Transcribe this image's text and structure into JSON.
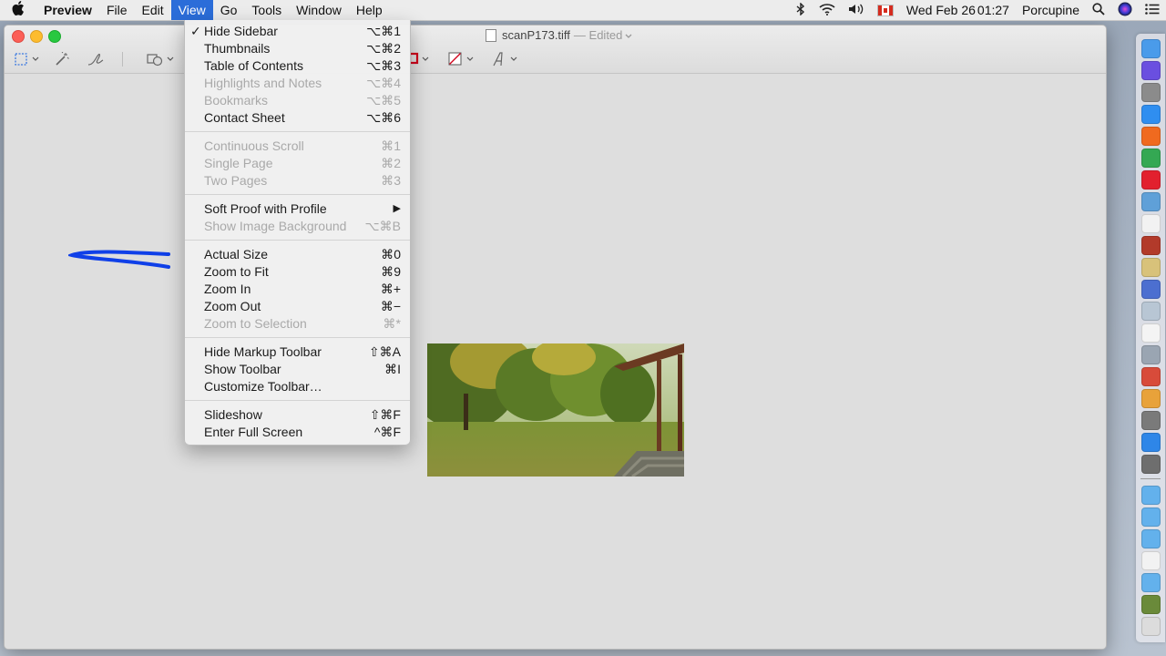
{
  "menubar": {
    "app_name": "Preview",
    "menus": [
      "File",
      "Edit",
      "View",
      "Go",
      "Tools",
      "Window",
      "Help"
    ],
    "date": "Wed Feb 26",
    "time": "01:27",
    "user": "Porcupine"
  },
  "window": {
    "title": "scanP173.tiff",
    "edited": "— Edited"
  },
  "view_menu": {
    "groups": [
      [
        {
          "label": "Hide Sidebar",
          "shortcut": "⌥⌘1",
          "checked": true
        },
        {
          "label": "Thumbnails",
          "shortcut": "⌥⌘2"
        },
        {
          "label": "Table of Contents",
          "shortcut": "⌥⌘3"
        },
        {
          "label": "Highlights and Notes",
          "shortcut": "⌥⌘4",
          "disabled": true
        },
        {
          "label": "Bookmarks",
          "shortcut": "⌥⌘5",
          "disabled": true
        },
        {
          "label": "Contact Sheet",
          "shortcut": "⌥⌘6"
        }
      ],
      [
        {
          "label": "Continuous Scroll",
          "shortcut": "⌘1",
          "disabled": true
        },
        {
          "label": "Single Page",
          "shortcut": "⌘2",
          "disabled": true
        },
        {
          "label": "Two Pages",
          "shortcut": "⌘3",
          "disabled": true
        }
      ],
      [
        {
          "label": "Soft Proof with Profile",
          "shortcut": "▶"
        },
        {
          "label": "Show Image Background",
          "shortcut": "⌥⌘B",
          "disabled": true
        }
      ],
      [
        {
          "label": "Actual Size",
          "shortcut": "⌘0"
        },
        {
          "label": "Zoom to Fit",
          "shortcut": "⌘9"
        },
        {
          "label": "Zoom In",
          "shortcut": "⌘+"
        },
        {
          "label": "Zoom Out",
          "shortcut": "⌘−"
        },
        {
          "label": "Zoom to Selection",
          "shortcut": "⌘*",
          "disabled": true
        }
      ],
      [
        {
          "label": "Hide Markup Toolbar",
          "shortcut": "⇧⌘A"
        },
        {
          "label": "Show Toolbar",
          "shortcut": "⌘I"
        },
        {
          "label": "Customize Toolbar…",
          "shortcut": ""
        }
      ],
      [
        {
          "label": "Slideshow",
          "shortcut": "⇧⌘F"
        },
        {
          "label": "Enter Full Screen",
          "shortcut": "^⌘F"
        }
      ]
    ]
  },
  "colors": {
    "menu_highlight": "#2b6dd9",
    "stroke_color": "#1040e8",
    "border_color": "#d0021b"
  },
  "icons": {
    "apple": "apple-icon",
    "status": [
      "bluetooth-icon",
      "wifi-icon",
      "volume-icon",
      "canada-flag-icon",
      "spotlight-icon",
      "siri-icon",
      "notification-center-icon"
    ]
  }
}
